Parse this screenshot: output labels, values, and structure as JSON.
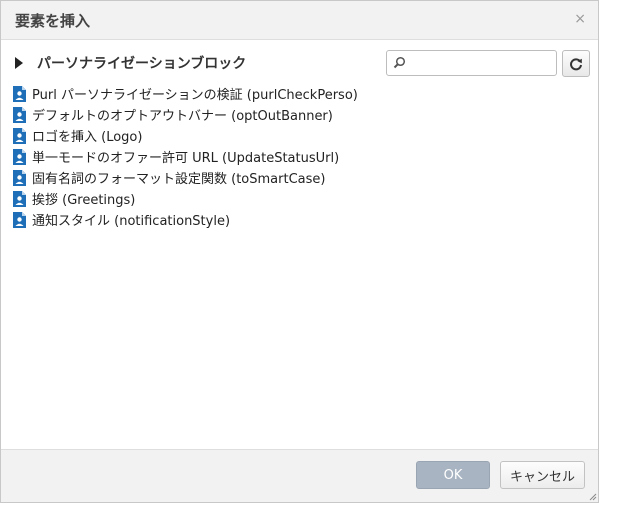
{
  "dialog": {
    "title": "要素を挿入",
    "close_glyph": "×"
  },
  "group": {
    "label": "パーソナライゼーションブロック",
    "expand_icon": "triangle-right-icon"
  },
  "search": {
    "value": "",
    "placeholder": "",
    "icon": "search-icon"
  },
  "refresh": {
    "icon": "refresh-icon"
  },
  "items": [
    {
      "label": "Purl パーソナライゼーションの検証 (purlCheckPerso)"
    },
    {
      "label": "デフォルトのオプトアウトバナー (optOutBanner)"
    },
    {
      "label": "ロゴを挿入 (Logo)"
    },
    {
      "label": "単一モードのオファー許可 URL (UpdateStatusUrl)"
    },
    {
      "label": "固有名詞のフォーマット設定関数 (toSmartCase)"
    },
    {
      "label": "挨拶 (Greetings)"
    },
    {
      "label": "通知スタイル (notificationStyle)"
    }
  ],
  "footer": {
    "ok_label": "OK",
    "cancel_label": "キャンセル"
  },
  "colors": {
    "item_icon_blue": "#1e6fb8",
    "ok_button": "#a9b4c2",
    "titlebar": "#f2f2f2"
  }
}
